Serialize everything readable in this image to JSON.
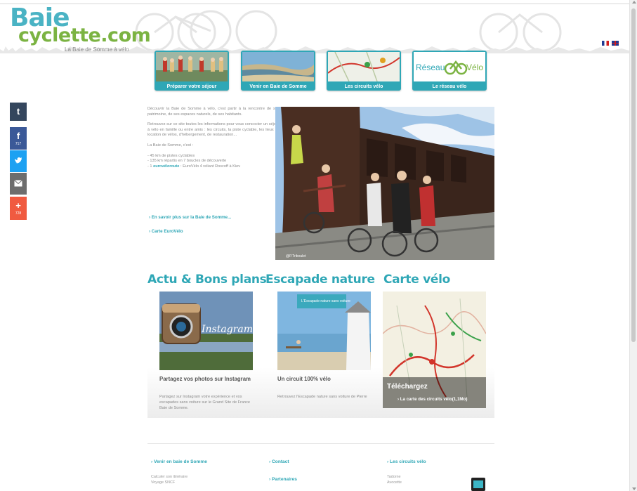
{
  "logo": {
    "line1": "Baie",
    "line2": "cyclette.com",
    "tagline": "La Baie de Somme à vélo"
  },
  "languages": [
    "fr-flag",
    "uk-flag"
  ],
  "nav": [
    {
      "label": "Préparer votre séjour",
      "thumb": "people-photo"
    },
    {
      "label": "Venir en Baie de Somme",
      "thumb": "coast-photo"
    },
    {
      "label": "Les circuits vélo",
      "thumb": "map-photo"
    },
    {
      "label": "Le réseau vélo",
      "thumb": "reseau-logo",
      "logo_text": "Réseau",
      "logo_text2": "Vélo"
    }
  ],
  "share": {
    "tumblr": "t",
    "facebook": "f",
    "facebook_count": "717",
    "twitter": "twitter-bird-icon",
    "mail": "mail-icon",
    "plus": "+",
    "plus_count": "728"
  },
  "intro": {
    "p1": "Découvrir la Baie de Somme à vélo, c'est partir à la rencontre de son patrimoine, de ses espaces naturels, de ses habitants.",
    "p2": "Retrouvez sur ce site toutes les informations pour vous concocter un séjour à vélo en famille ou entre amis : les circuits, la piste cyclable, les lieux de location de vélos, d'hébergement, de restauration...",
    "p3": "La Baie de Somme, c'est :",
    "list1": "- 45 km de pistes cyclables",
    "list2": "- 135 km répartis en 7 boucles de découverte",
    "list3_hl": "eurovéloroute",
    "list3_pre": "- 1 ",
    "list3_post": " : EuroVélo 4 reliant Roscoff à Kiev",
    "link1": "› En savoir plus sur la Baie de Somme...",
    "link2": "› Carte EuroVélo"
  },
  "hero": {
    "credit": "@P.Triboulet"
  },
  "sections": {
    "actu_title": "Actu & Bons plans",
    "nature_title": "Escapade nature",
    "carte_title": "Carte vélo"
  },
  "cards": {
    "insta_overlay": "Instagram",
    "insta_title": "Partagez vos photos sur Instagram",
    "insta_text": "Partagez sur Instagram votre expérience et vos escapades sans voiture sur le Grand Site de France Baie de Somme.",
    "nature_title": "Un circuit 100% vélo",
    "nature_text": "Retrouvez l'Escapade nature sans voiture de Pierre",
    "nature_sign": "L'Escapade nature sans voiture",
    "carte_overlay": "Téléchargez",
    "carte_link": "› La carte des circuits vélo(1,1Mo)"
  },
  "footer": {
    "col1_link": "› Venir en baie de Somme",
    "col1_line1": "Calculer son itinéraire",
    "col1_line2": "Voyage SNCF",
    "col2_link1": "› Contact",
    "col2_link2": "› Partenaires",
    "col3_link": "› Les circuits vélo",
    "col3_line1": "Tadorne",
    "col3_line2": "Avocette"
  },
  "colors": {
    "accent": "#2fa7b6",
    "logo_green": "#7bb342",
    "logo_blue": "#4ab3c4"
  }
}
